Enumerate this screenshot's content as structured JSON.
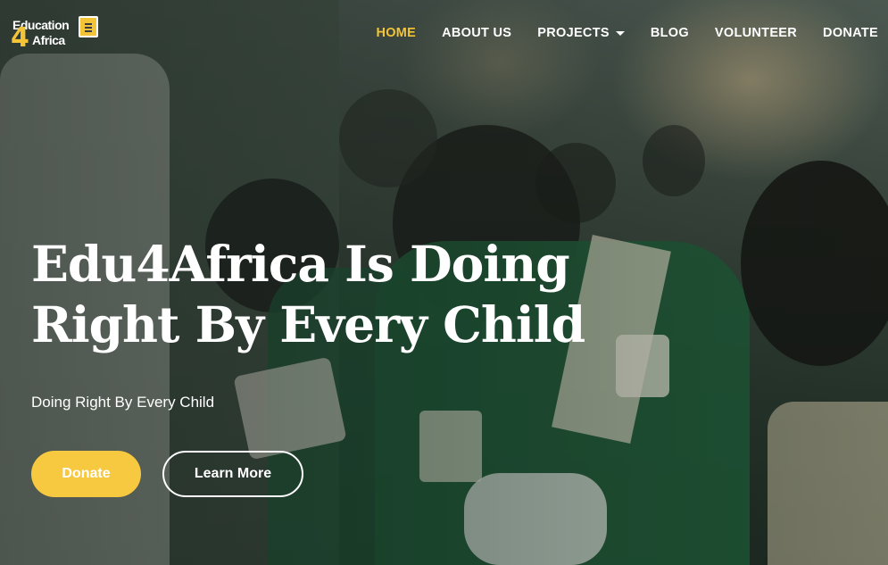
{
  "header": {
    "logo": {
      "line1": "Education",
      "number": "4",
      "line2": "Africa",
      "icon": "open-book-icon"
    },
    "nav": [
      {
        "label": "HOME",
        "active": true
      },
      {
        "label": "ABOUT US",
        "active": false
      },
      {
        "label": "PROJECTS",
        "active": false,
        "dropdown": true
      },
      {
        "label": "BLOG",
        "active": false
      },
      {
        "label": "VOLUNTEER",
        "active": false
      },
      {
        "label": "DONATE",
        "active": false
      }
    ]
  },
  "hero": {
    "title_line1": "Edu4Africa Is Doing",
    "title_line2": "Right By Every Child",
    "subtitle": "Doing Right By Every Child",
    "primary_button": "Donate",
    "secondary_button": "Learn More"
  },
  "colors": {
    "accent": "#f3c437",
    "button_primary": "#f7c940",
    "text": "#ffffff"
  }
}
